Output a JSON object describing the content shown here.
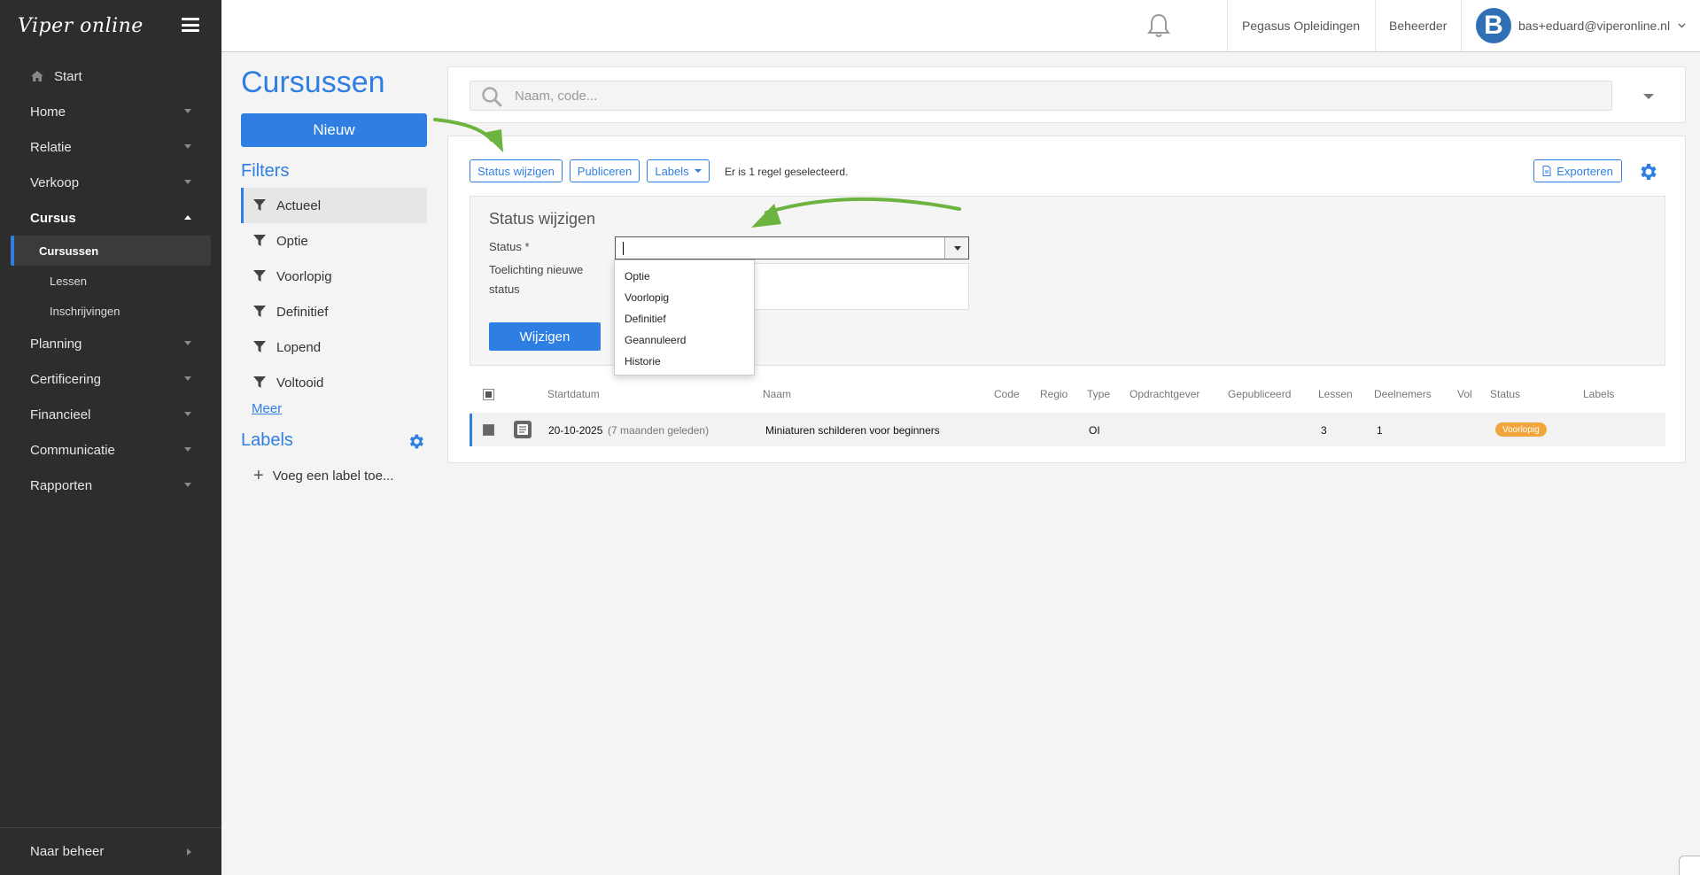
{
  "app": {
    "logo": "Viper online"
  },
  "sidebar": {
    "start": "Start",
    "items": [
      {
        "label": "Home"
      },
      {
        "label": "Relatie"
      },
      {
        "label": "Verkoop"
      },
      {
        "label": "Cursus"
      },
      {
        "label": "Planning"
      },
      {
        "label": "Certificering"
      },
      {
        "label": "Financieel"
      },
      {
        "label": "Communicatie"
      },
      {
        "label": "Rapporten"
      }
    ],
    "cursus_sub": [
      {
        "label": "Cursussen"
      },
      {
        "label": "Lessen"
      },
      {
        "label": "Inschrijvingen"
      }
    ],
    "footer": "Naar beheer"
  },
  "topbar": {
    "org": "Pegasus Opleidingen",
    "role": "Beheerder",
    "avatar_letter": "B",
    "user": "bas+eduard@viperonline.nl"
  },
  "page": {
    "title": "Cursussen",
    "new_button": "Nieuw",
    "filters_title": "Filters",
    "filters": [
      {
        "label": "Actueel"
      },
      {
        "label": "Optie"
      },
      {
        "label": "Voorlopig"
      },
      {
        "label": "Definitief"
      },
      {
        "label": "Lopend"
      },
      {
        "label": "Voltooid"
      }
    ],
    "meer": "Meer",
    "labels_title": "Labels",
    "add_label": "Voeg een label toe..."
  },
  "search": {
    "placeholder": "Naam, code..."
  },
  "toolbar": {
    "status_wijzigen": "Status wijzigen",
    "publiceren": "Publiceren",
    "labels": "Labels",
    "selection_text": "Er is 1 regel geselecteerd.",
    "exporteren": "Exporteren"
  },
  "status_panel": {
    "title": "Status wijzigen",
    "status_label": "Status *",
    "toelichting_label_1": "Toelichting nieuwe",
    "toelichting_label_2": "status",
    "submit": "Wijzigen",
    "options": [
      "Optie",
      "Voorlopig",
      "Definitief",
      "Geannuleerd",
      "Historie"
    ]
  },
  "table": {
    "columns": {
      "startdatum": "Startdatum",
      "naam": "Naam",
      "code": "Code",
      "regio": "Regio",
      "type": "Type",
      "opdrachtgever": "Opdrachtgever",
      "gepubliceerd": "Gepubliceerd",
      "lessen": "Lessen",
      "deelnemers": "Deelnemers",
      "vol": "Vol",
      "status": "Status",
      "labels": "Labels"
    },
    "rows": [
      {
        "startdatum": "20-10-2025",
        "relative": "(7 maanden geleden)",
        "naam": "Miniaturen schilderen voor beginners",
        "type": "OI",
        "lessen": "3",
        "deelnemers": "1",
        "status": "Voorlopig"
      }
    ]
  },
  "colors": {
    "accent": "#2f7fe3",
    "sidebar_bg": "#2d2d2d",
    "badge": "#f0a63a",
    "arrow": "#6db33f"
  }
}
